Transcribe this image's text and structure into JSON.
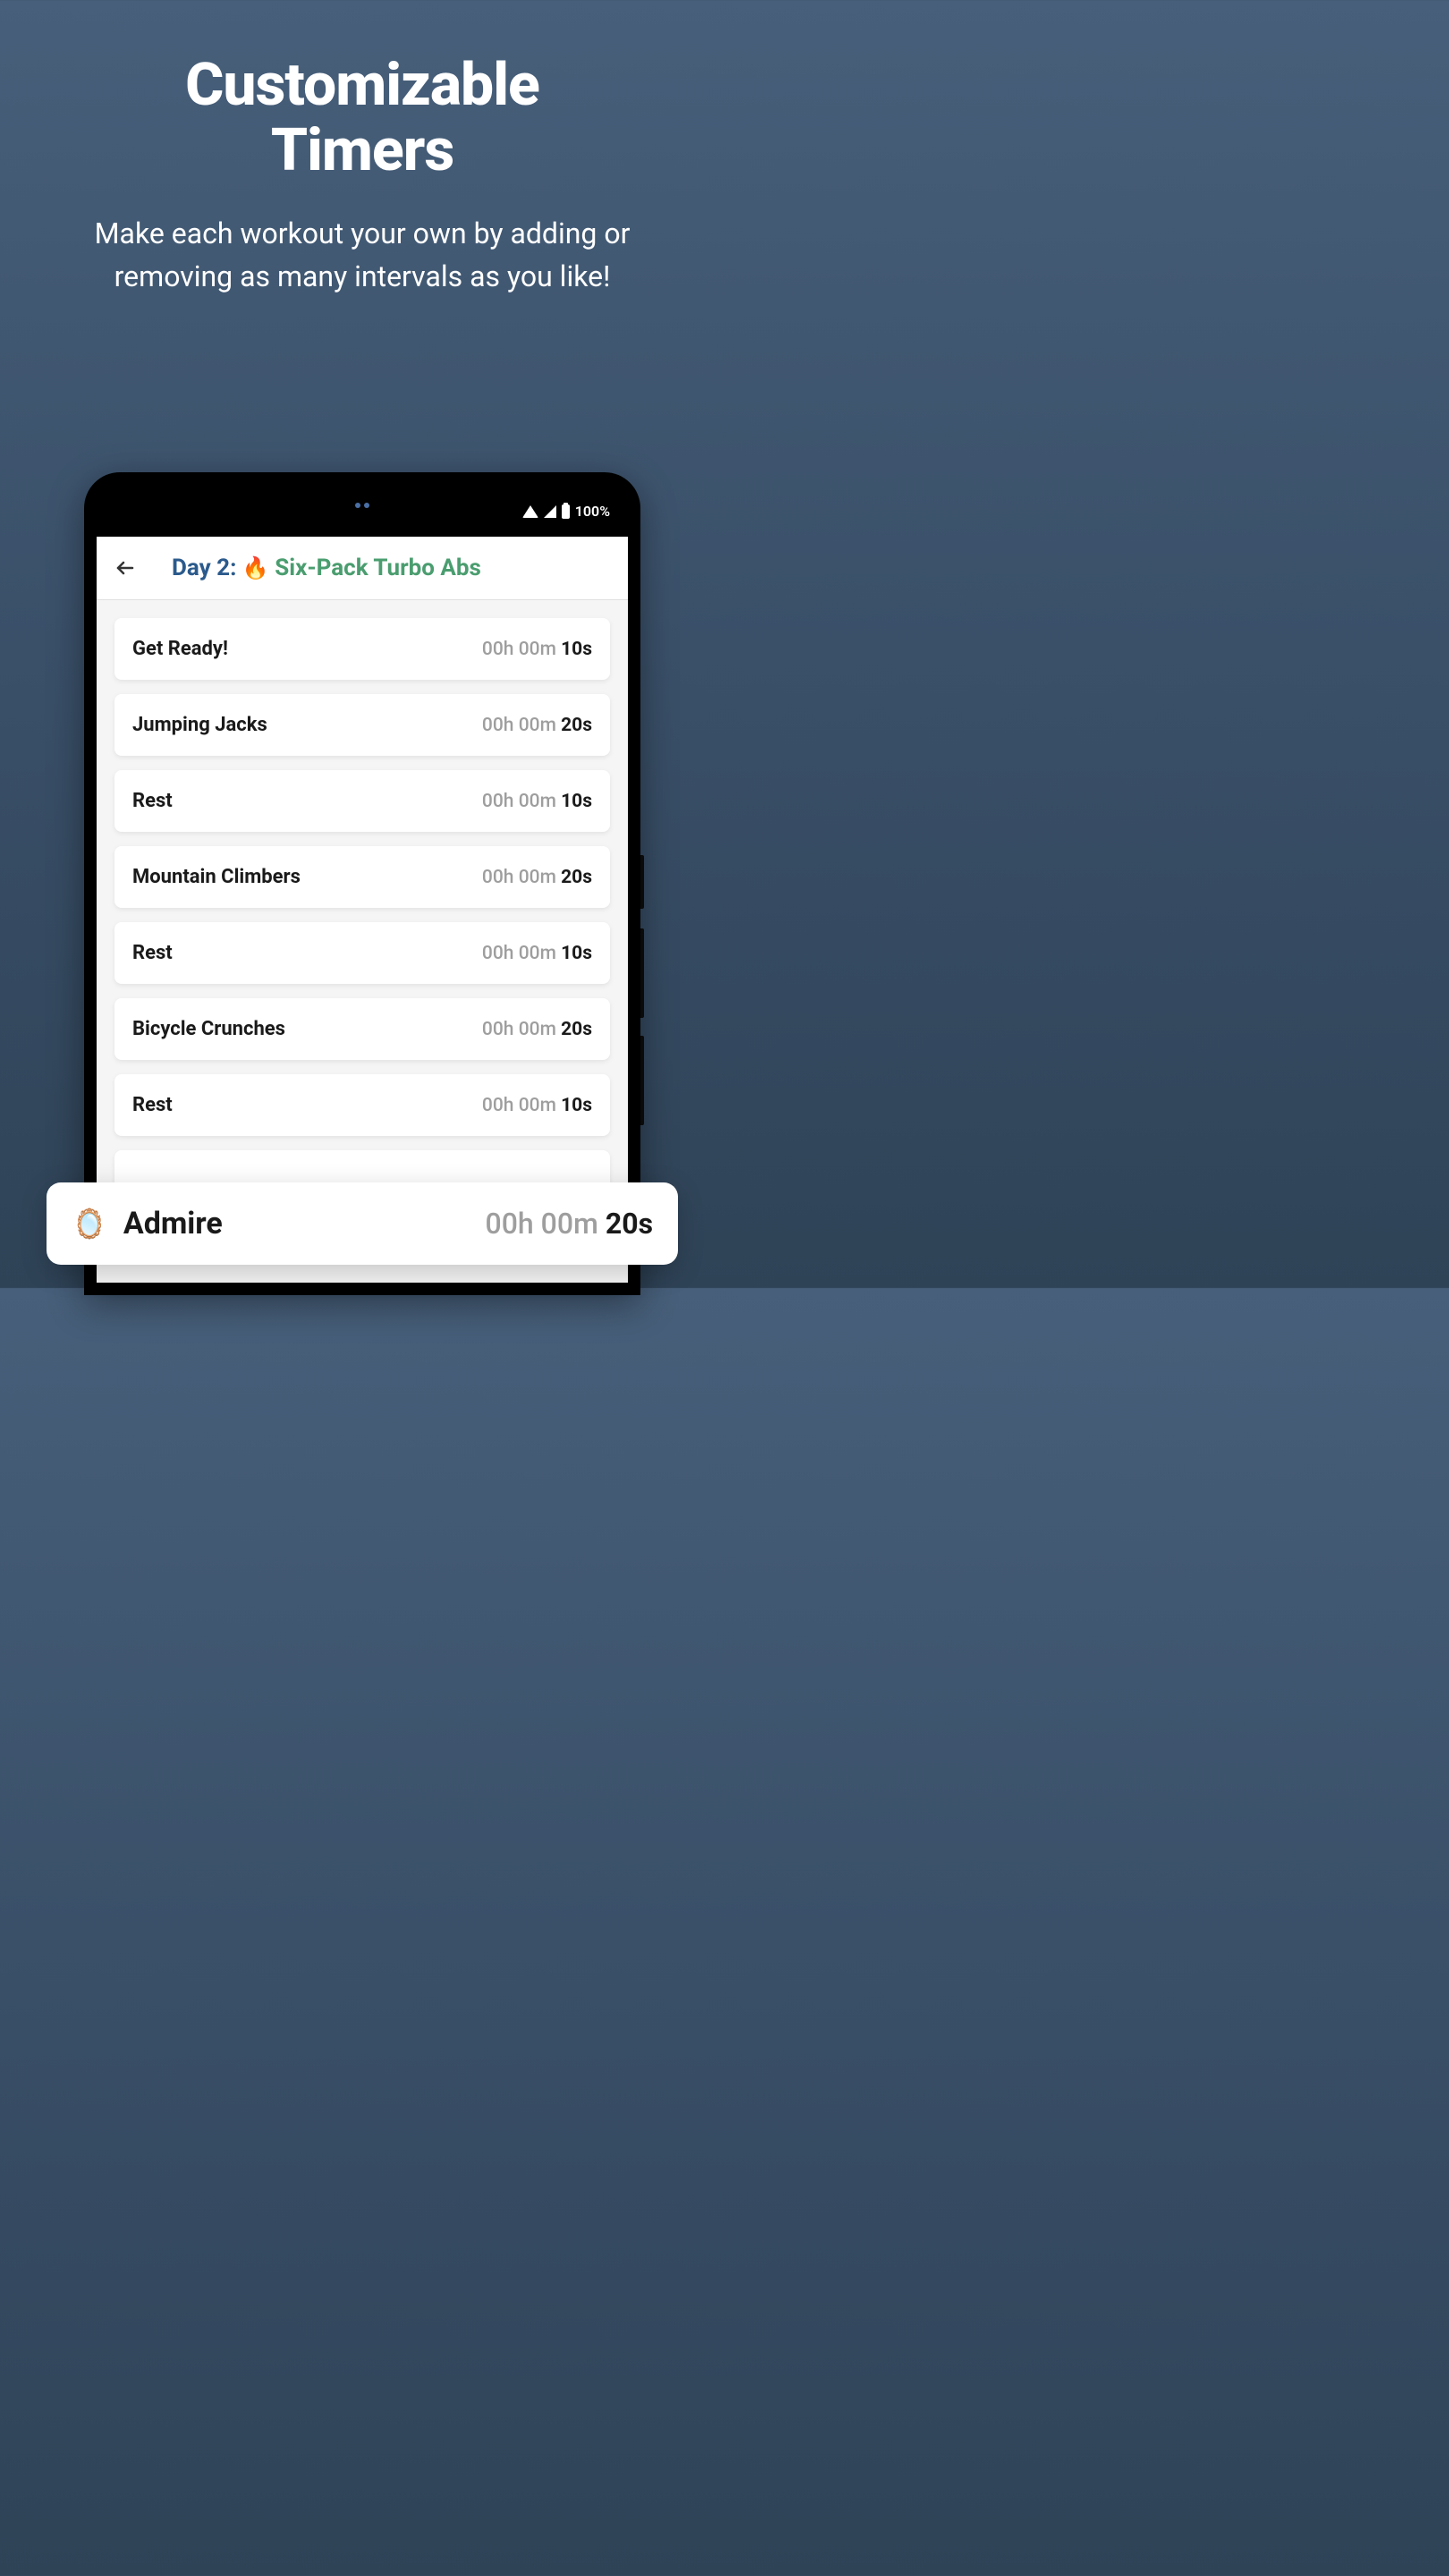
{
  "hero": {
    "title_line1": "Customizable",
    "title_line2": "Timers",
    "subtitle": "Make each workout your own by adding or removing as many intervals as you like!"
  },
  "status_bar": {
    "battery_text": "100%"
  },
  "header": {
    "day_label": "Day 2:",
    "emoji": "🔥",
    "workout_name": "Six-Pack Turbo Abs"
  },
  "intervals": [
    {
      "name": "Get Ready!",
      "hours": "00h",
      "minutes": "00m",
      "seconds": "10s"
    },
    {
      "name": "Jumping Jacks",
      "hours": "00h",
      "minutes": "00m",
      "seconds": "20s"
    },
    {
      "name": "Rest",
      "hours": "00h",
      "minutes": "00m",
      "seconds": "10s"
    },
    {
      "name": "Mountain Climbers",
      "hours": "00h",
      "minutes": "00m",
      "seconds": "20s"
    },
    {
      "name": "Rest",
      "hours": "00h",
      "minutes": "00m",
      "seconds": "10s"
    },
    {
      "name": "Bicycle Crunches",
      "hours": "00h",
      "minutes": "00m",
      "seconds": "20s"
    },
    {
      "name": "Rest",
      "hours": "00h",
      "minutes": "00m",
      "seconds": "10s"
    }
  ],
  "floating": {
    "icon": "🪞",
    "name": "Admire",
    "hours": "00h",
    "minutes": "00m",
    "seconds": "20s"
  }
}
